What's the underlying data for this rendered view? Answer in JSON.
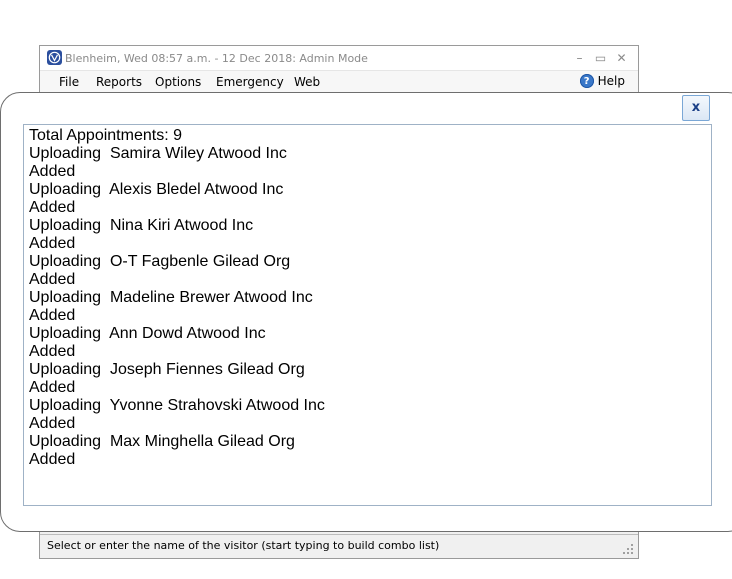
{
  "main_window": {
    "title": "Blenheim, Wed 08:57 a.m. - 12 Dec 2018: Admin Mode",
    "controls": {
      "minimize": "–",
      "maximize": "▭",
      "close": "✕"
    },
    "menu": [
      "File",
      "Reports",
      "Options",
      "Emergency",
      "Web"
    ],
    "help_label": "Help",
    "status_text": "Select or enter the name of the visitor (start typing to build combo list)"
  },
  "dialog": {
    "close_label": "x",
    "log_lines": [
      "Total Appointments: 9",
      "Uploading  Samira Wiley Atwood Inc",
      "Added",
      "Uploading  Alexis Bledel Atwood Inc",
      "Added",
      "Uploading  Nina Kiri Atwood Inc",
      "Added",
      "Uploading  O-T Fagbenle Gilead Org",
      "Added",
      "Uploading  Madeline Brewer Atwood Inc",
      "Added",
      "Uploading  Ann Dowd Atwood Inc",
      "Added",
      "Uploading  Joseph Fiennes Gilead Org",
      "Added",
      "Uploading  Yvonne Strahovski Atwood Inc",
      "Added",
      "Uploading  Max Minghella Gilead Org",
      "Added"
    ]
  },
  "colors": {
    "accent": "#2b4f9e",
    "close_button_border": "#7aa7d6",
    "log_border": "#9fb2c6"
  }
}
